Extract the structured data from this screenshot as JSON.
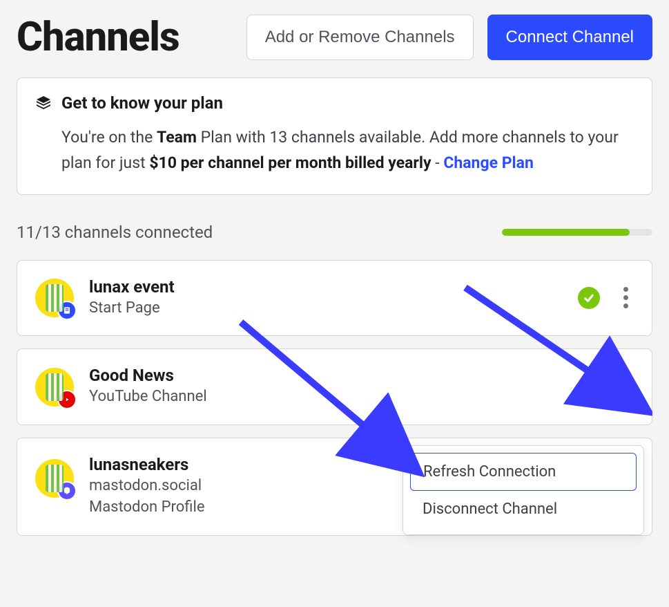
{
  "header": {
    "title": "Channels",
    "add_remove_label": "Add or Remove Channels",
    "connect_label": "Connect Channel"
  },
  "plan_info": {
    "title": "Get to know your plan",
    "body_pre": "You're on the ",
    "plan_name": "Team",
    "body_mid1": " Plan with 13 channels available. Add more channels to your plan for just ",
    "price_bold": "$10 per channel per month billed yearly",
    "body_mid2": " - ",
    "change_plan_label": "Change Plan"
  },
  "status": {
    "text": "11/13 channels connected",
    "progress_percent": 85
  },
  "channels": [
    {
      "name": "lunax event",
      "subtitle": "Start Page",
      "badge": "bluepage",
      "connected": true
    },
    {
      "name": "Good News",
      "subtitle": "YouTube Channel",
      "badge": "youtube",
      "connected": true
    },
    {
      "name": "lunasneakers",
      "subtitle": "mastodon.social\nMastodon Profile",
      "badge": "mastodon",
      "connected": true
    }
  ],
  "dropdown": {
    "refresh": "Refresh Connection",
    "disconnect": "Disconnect Channel"
  }
}
